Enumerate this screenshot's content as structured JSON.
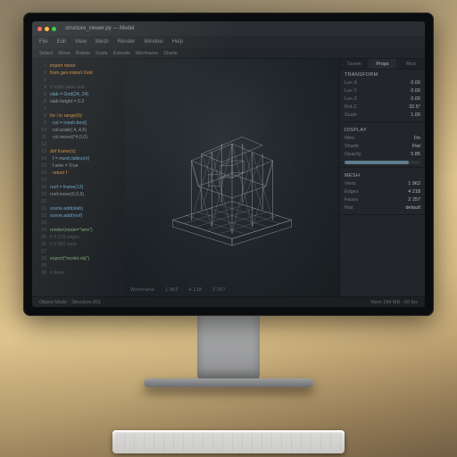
{
  "window": {
    "title": "structure_viewer.py — Model",
    "traffic": [
      "close",
      "min",
      "max"
    ]
  },
  "menu": [
    "File",
    "Edit",
    "View",
    "Mesh",
    "Render",
    "Window",
    "Help"
  ],
  "toolbar": [
    "Select",
    "Move",
    "Rotate",
    "Scale",
    "Extrude",
    "Wireframe",
    "Shade"
  ],
  "code": [
    {
      "n": "1",
      "t": "import mesh",
      "cls": "kw"
    },
    {
      "n": "2",
      "t": "from geo import Grid",
      "cls": "kw"
    },
    {
      "n": "3",
      "t": "",
      "cls": ""
    },
    {
      "n": "4",
      "t": "# build base slab",
      "cls": "cm"
    },
    {
      "n": "5",
      "t": "slab = Grid(24, 24)",
      "cls": "fn"
    },
    {
      "n": "6",
      "t": "slab.height = 0.2",
      "cls": ""
    },
    {
      "n": "7",
      "t": "",
      "cls": ""
    },
    {
      "n": "8",
      "t": "for i in range(6):",
      "cls": "kw"
    },
    {
      "n": "9",
      "t": "  col = mesh.box()",
      "cls": "fn"
    },
    {
      "n": "10",
      "t": "  col.scale(.4,.4,6)",
      "cls": ""
    },
    {
      "n": "11",
      "t": "  col.move(i*4,0,0)",
      "cls": ""
    },
    {
      "n": "12",
      "t": "",
      "cls": ""
    },
    {
      "n": "13",
      "t": "def frame(n):",
      "cls": "kw"
    },
    {
      "n": "14",
      "t": "  f = mesh.lattice(n)",
      "cls": "fn"
    },
    {
      "n": "15",
      "t": "  f.wire = True",
      "cls": ""
    },
    {
      "n": "16",
      "t": "  return f",
      "cls": "kw"
    },
    {
      "n": "17",
      "t": "",
      "cls": ""
    },
    {
      "n": "18",
      "t": "roof = frame(12)",
      "cls": "fn"
    },
    {
      "n": "19",
      "t": "roof.move(0,0,6)",
      "cls": ""
    },
    {
      "n": "20",
      "t": "",
      "cls": ""
    },
    {
      "n": "21",
      "t": "scene.add(slab)",
      "cls": "fn"
    },
    {
      "n": "22",
      "t": "scene.add(roof)",
      "cls": "fn"
    },
    {
      "n": "23",
      "t": "",
      "cls": ""
    },
    {
      "n": "24",
      "t": "render(mode=\"wire\")",
      "cls": "str"
    },
    {
      "n": "25",
      "t": "# 4 218 edges",
      "cls": "cm"
    },
    {
      "n": "26",
      "t": "# 1 962 verts",
      "cls": "cm"
    },
    {
      "n": "27",
      "t": "",
      "cls": ""
    },
    {
      "n": "28",
      "t": "export(\"model.obj\")",
      "cls": "str"
    },
    {
      "n": "29",
      "t": "",
      "cls": ""
    },
    {
      "n": "30",
      "t": "# done",
      "cls": "cm"
    }
  ],
  "viewport": {
    "object_label": "Structure.001",
    "mode": "Wireframe",
    "verts": "1 962",
    "edges": "4 218",
    "faces": "2 257"
  },
  "panel": {
    "tabs": [
      "Scene",
      "Props",
      "Mod"
    ],
    "active_tab": 1,
    "sections": [
      {
        "title": "Transform",
        "rows": [
          {
            "k": "Loc X",
            "v": "0.00"
          },
          {
            "k": "Loc Y",
            "v": "0.00"
          },
          {
            "k": "Loc Z",
            "v": "0.00"
          },
          {
            "k": "Rot Z",
            "v": "32.5°"
          },
          {
            "k": "Scale",
            "v": "1.00"
          }
        ]
      },
      {
        "title": "Display",
        "rows": [
          {
            "k": "Wire",
            "v": "On"
          },
          {
            "k": "Shade",
            "v": "Flat"
          },
          {
            "k": "Opacity",
            "v": "0.85"
          }
        ],
        "bar": 85
      },
      {
        "title": "Mesh",
        "rows": [
          {
            "k": "Verts",
            "v": "1 962"
          },
          {
            "k": "Edges",
            "v": "4 218"
          },
          {
            "k": "Faces",
            "v": "2 257"
          },
          {
            "k": "Mat",
            "v": "default"
          }
        ]
      }
    ]
  },
  "status": {
    "left": "Object Mode · Structure.001",
    "right": "Mem 184 MB  ·  60 fps"
  }
}
